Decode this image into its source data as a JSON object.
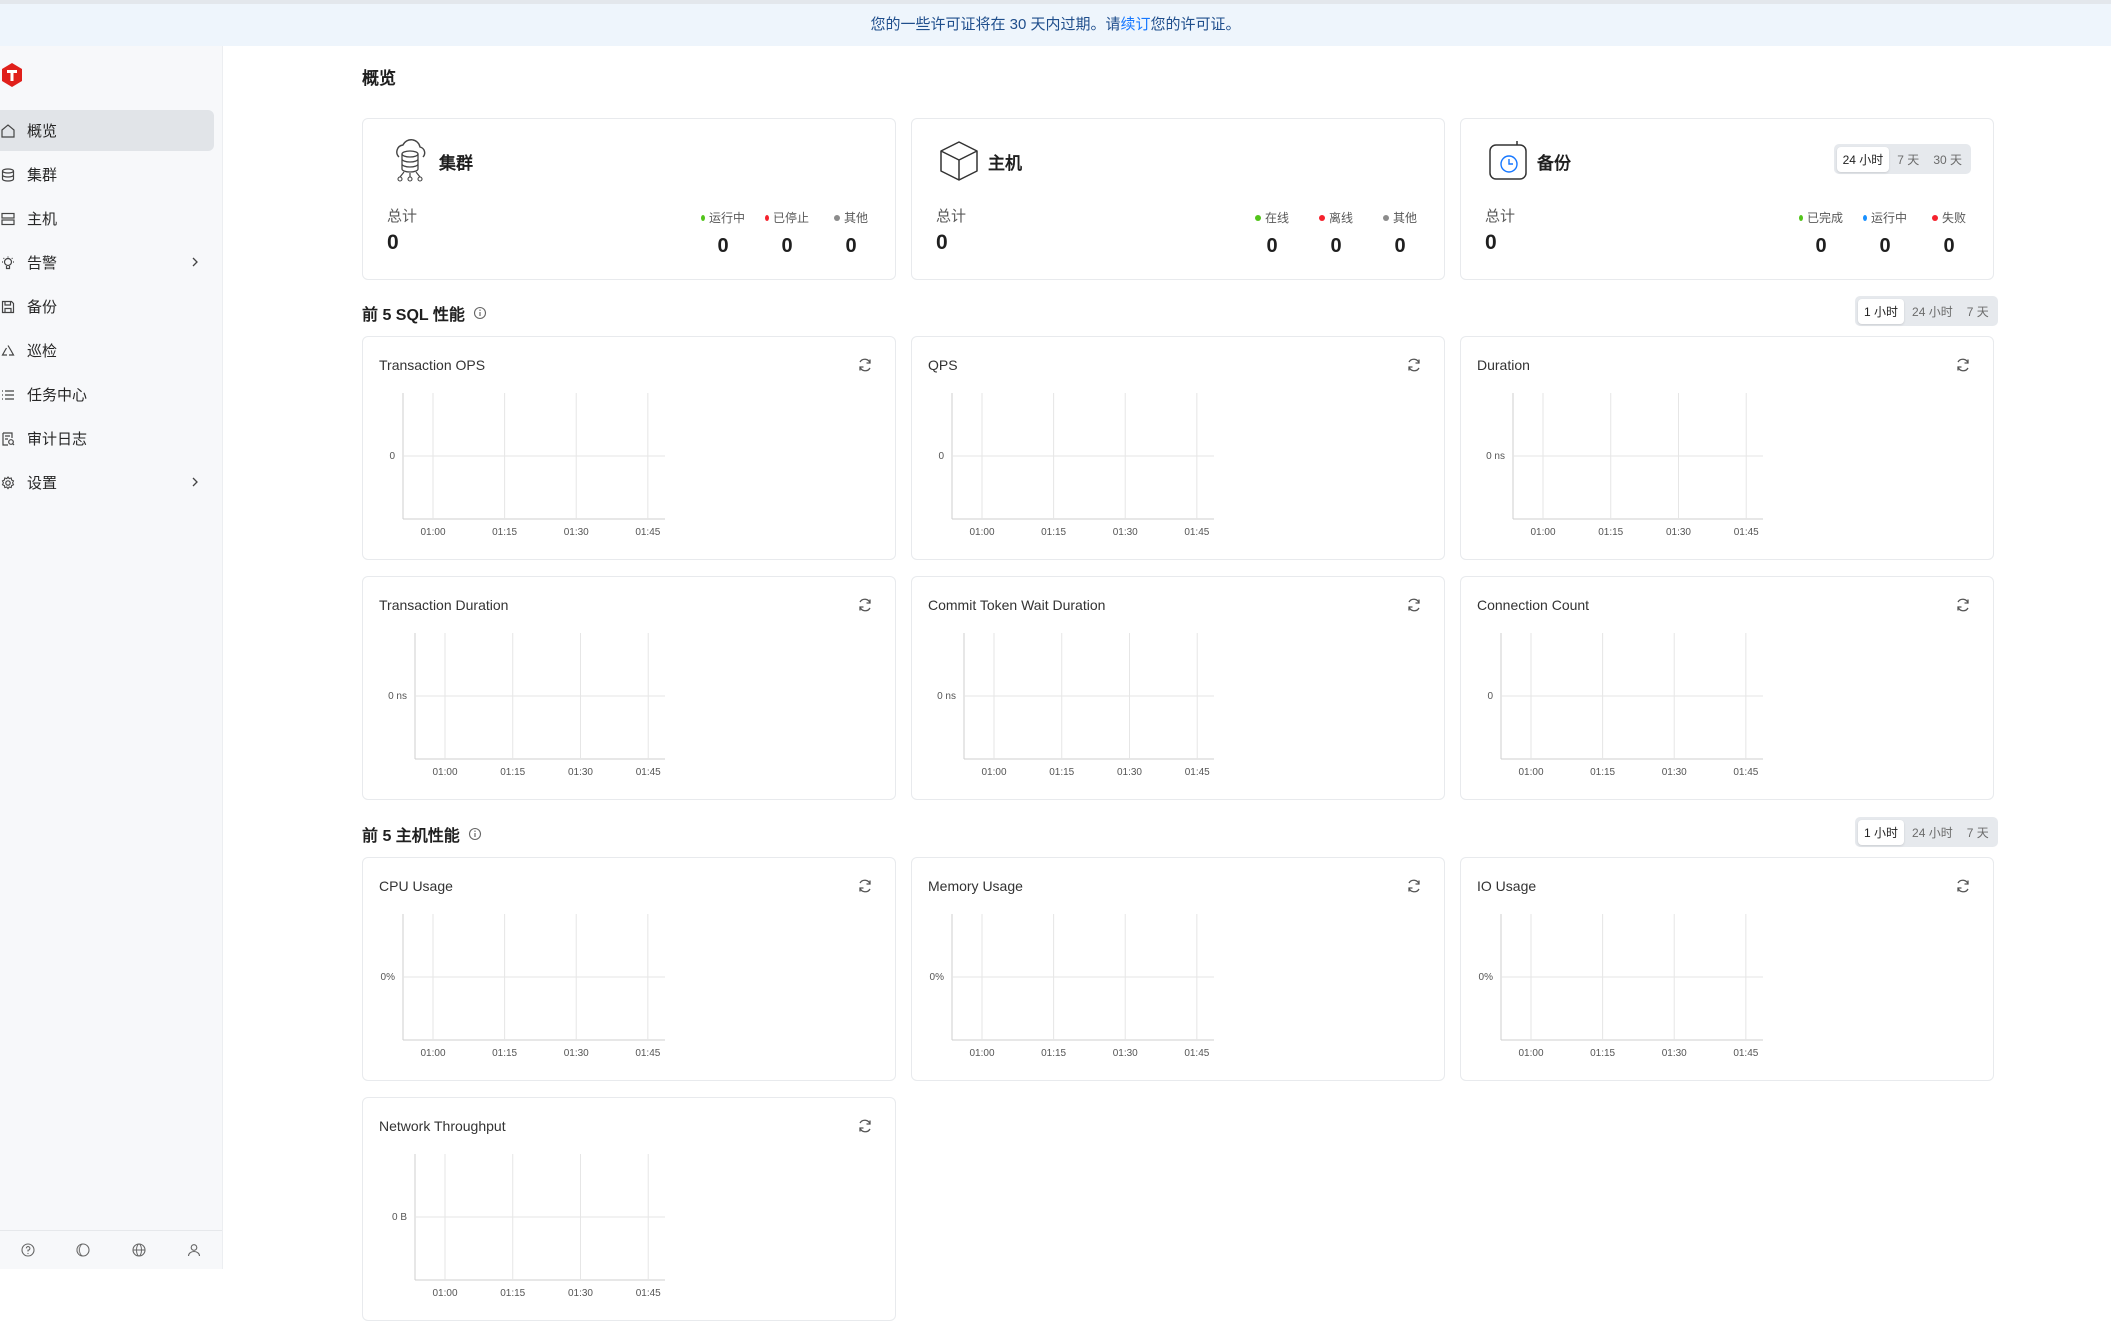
{
  "banner": {
    "text_before": "您的一些许可证将在 30 天内过期。请",
    "link": "续订",
    "text_after": "您的许可证。"
  },
  "sidebar": {
    "items": [
      {
        "label": "概览",
        "icon": "home-icon",
        "active": true
      },
      {
        "label": "集群",
        "icon": "database-icon"
      },
      {
        "label": "主机",
        "icon": "server-icon"
      },
      {
        "label": "告警",
        "icon": "bulb-icon",
        "expandable": true
      },
      {
        "label": "备份",
        "icon": "save-icon"
      },
      {
        "label": "巡检",
        "icon": "recycle-icon"
      },
      {
        "label": "任务中心",
        "icon": "list-icon"
      },
      {
        "label": "审计日志",
        "icon": "audit-icon"
      },
      {
        "label": "设置",
        "icon": "gear-icon",
        "expandable": true
      }
    ],
    "footer_icons": [
      "help-icon",
      "theme-icon",
      "globe-icon",
      "user-icon"
    ]
  },
  "page_title": "概览",
  "stats": [
    {
      "title": "集群",
      "total_label": "总计",
      "total": "0",
      "legend": [
        {
          "label": "运行中",
          "color": "#52c41a",
          "value": "0"
        },
        {
          "label": "已停止",
          "color": "#f5222d",
          "value": "0"
        },
        {
          "label": "其他",
          "color": "#8c8c8c",
          "value": "0"
        }
      ]
    },
    {
      "title": "主机",
      "total_label": "总计",
      "total": "0",
      "legend": [
        {
          "label": "在线",
          "color": "#52c41a",
          "value": "0"
        },
        {
          "label": "离线",
          "color": "#f5222d",
          "value": "0"
        },
        {
          "label": "其他",
          "color": "#8c8c8c",
          "value": "0"
        }
      ]
    },
    {
      "title": "备份",
      "total_label": "总计",
      "total": "0",
      "legend": [
        {
          "label": "已完成",
          "color": "#52c41a",
          "value": "0"
        },
        {
          "label": "运行中",
          "color": "#1890ff",
          "value": "0"
        },
        {
          "label": "失败",
          "color": "#f5222d",
          "value": "0"
        }
      ],
      "ranges": [
        "24 小时",
        "7 天",
        "30 天"
      ],
      "range_selected": 0
    }
  ],
  "sql_section": {
    "title": "前 5 SQL 性能",
    "ranges": [
      "1 小时",
      "24 小时",
      "7 天"
    ],
    "range_selected": 0
  },
  "host_section": {
    "title": "前 5 主机性能",
    "ranges": [
      "1 小时",
      "24 小时",
      "7 天"
    ],
    "range_selected": 0
  },
  "chart_data": [
    {
      "type": "line",
      "title": "Transaction OPS",
      "x_ticks": [
        "01:00",
        "01:15",
        "01:30",
        "01:45"
      ],
      "y_ticks": [
        "0"
      ],
      "series": []
    },
    {
      "type": "line",
      "title": "QPS",
      "x_ticks": [
        "01:00",
        "01:15",
        "01:30",
        "01:45"
      ],
      "y_ticks": [
        "0"
      ],
      "series": []
    },
    {
      "type": "line",
      "title": "Duration",
      "x_ticks": [
        "01:00",
        "01:15",
        "01:30",
        "01:45"
      ],
      "y_ticks": [
        "0 ns"
      ],
      "series": []
    },
    {
      "type": "line",
      "title": "Transaction Duration",
      "x_ticks": [
        "01:00",
        "01:15",
        "01:30",
        "01:45"
      ],
      "y_ticks": [
        "0 ns"
      ],
      "series": []
    },
    {
      "type": "line",
      "title": "Commit Token Wait Duration",
      "x_ticks": [
        "01:00",
        "01:15",
        "01:30",
        "01:45"
      ],
      "y_ticks": [
        "0 ns"
      ],
      "series": []
    },
    {
      "type": "line",
      "title": "Connection Count",
      "x_ticks": [
        "01:00",
        "01:15",
        "01:30",
        "01:45"
      ],
      "y_ticks": [
        "0"
      ],
      "series": []
    },
    {
      "type": "line",
      "title": "CPU Usage",
      "x_ticks": [
        "01:00",
        "01:15",
        "01:30",
        "01:45"
      ],
      "y_ticks": [
        "0%"
      ],
      "series": []
    },
    {
      "type": "line",
      "title": "Memory Usage",
      "x_ticks": [
        "01:00",
        "01:15",
        "01:30",
        "01:45"
      ],
      "y_ticks": [
        "0%"
      ],
      "series": []
    },
    {
      "type": "line",
      "title": "IO Usage",
      "x_ticks": [
        "01:00",
        "01:15",
        "01:30",
        "01:45"
      ],
      "y_ticks": [
        "0%"
      ],
      "series": []
    },
    {
      "type": "line",
      "title": "Network Throughput",
      "x_ticks": [
        "01:00",
        "01:15",
        "01:30",
        "01:45"
      ],
      "y_ticks": [
        "0 B"
      ],
      "series": []
    }
  ]
}
